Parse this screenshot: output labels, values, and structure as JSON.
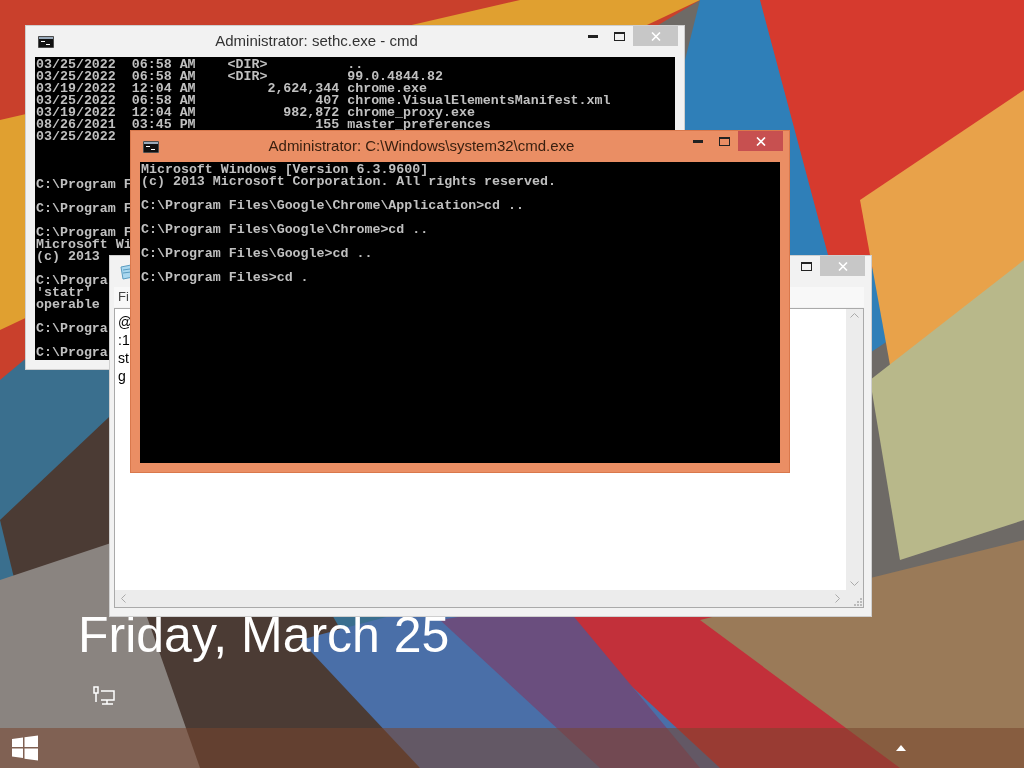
{
  "lock_screen": {
    "date": "Friday, March 25"
  },
  "windows": [
    {
      "kind": "console",
      "title": "Administrator: sethc.exe - cmd",
      "active": false,
      "controls": [
        {
          "kind": "minimize"
        },
        {
          "kind": "maximize"
        },
        {
          "kind": "close"
        }
      ],
      "blocks": [
        [
          "03/25/2022  06:58 AM    <DIR>          ..",
          "03/25/2022  06:58 AM    <DIR>          99.0.4844.82",
          "03/19/2022  12:04 AM         2,624,344 chrome.exe",
          "03/25/2022  06:58 AM               407 chrome.VisualElementsManifest.xml",
          "03/19/2022  12:04 AM           982,872 chrome_proxy.exe",
          "08/26/2021  03:45 PM               155 master_preferences",
          "03/25/2022"
        ],
        [
          "C:\\Program F"
        ],
        [
          "C:\\Program F"
        ],
        [
          "C:\\Program F",
          "Microsoft Wi",
          "(c) 2013"
        ],
        [
          "C:\\Progra",
          "'statr'",
          "operable"
        ],
        [
          "C:\\Progra"
        ],
        [
          "C:\\Progra"
        ]
      ]
    },
    {
      "kind": "notepad",
      "active": false,
      "controls": [
        {
          "kind": "maximize"
        },
        {
          "kind": "close"
        }
      ],
      "menu": [
        "Fi"
      ],
      "lines": [
        "@",
        ":1",
        "st",
        "g"
      ]
    },
    {
      "kind": "console",
      "title": "Administrator: C:\\Windows\\system32\\cmd.exe",
      "active": true,
      "controls": [
        {
          "kind": "minimize"
        },
        {
          "kind": "maximize"
        },
        {
          "kind": "close"
        }
      ],
      "blocks": [
        [
          "Microsoft Windows [Version 6.3.9600]",
          "(c) 2013 Microsoft Corporation. All rights reserved."
        ],
        [
          "C:\\Program Files\\Google\\Chrome\\Application>cd .."
        ],
        [
          "C:\\Program Files\\Google\\Chrome>cd .."
        ],
        [
          "C:\\Program Files\\Google>cd .."
        ],
        [
          "C:\\Program Files>cd ."
        ]
      ]
    }
  ]
}
